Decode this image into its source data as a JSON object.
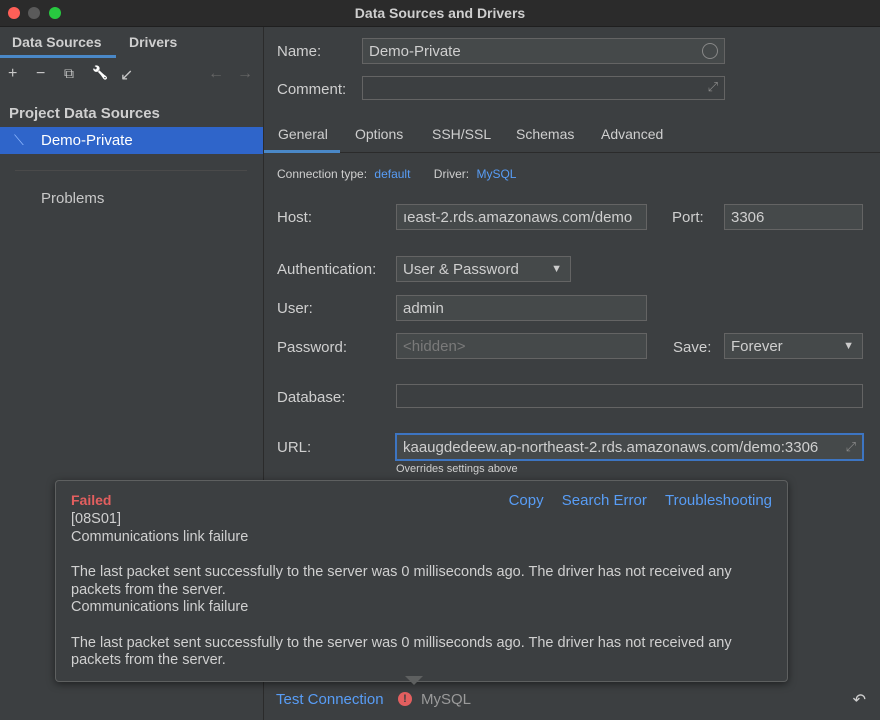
{
  "window": {
    "title": "Data Sources and Drivers"
  },
  "left": {
    "tabs": [
      "Data Sources",
      "Drivers"
    ],
    "section_title": "Project Data Sources",
    "data_source": "Demo-Private",
    "problems": "Problems",
    "toolbar": {
      "add": "+",
      "remove": "−",
      "copy": "⧉",
      "settings": "🔧",
      "import": "↙",
      "back": "←",
      "forward": "→"
    }
  },
  "form": {
    "name_label": "Name:",
    "name_value": "Demo-Private",
    "comment_label": "Comment:",
    "comment_value": "",
    "tabs": [
      "General",
      "Options",
      "SSH/SSL",
      "Schemas",
      "Advanced"
    ],
    "connection_type_label": "Connection type:",
    "connection_type": "default",
    "driver_label": "Driver:",
    "driver": "MySQL",
    "host_label": "Host:",
    "host_value": "ıeast-2.rds.amazonaws.com/demo",
    "port_label": "Port:",
    "port_value": "3306",
    "auth_label": "Authentication:",
    "auth_value": "User & Password",
    "user_label": "User:",
    "user_value": "admin",
    "password_label": "Password:",
    "password_placeholder": "<hidden>",
    "save_label": "Save:",
    "save_value": "Forever",
    "database_label": "Database:",
    "database_value": "",
    "url_label": "URL:",
    "url_value": "kaaugdedeew.ap-northeast-2.rds.amazonaws.com/demo:3306",
    "url_hint": "Overrides settings above"
  },
  "error_popup": {
    "status": "Failed",
    "actions": [
      "Copy",
      "Search Error",
      "Troubleshooting"
    ],
    "code": "[08S01]",
    "line1": "Communications link failure",
    "line2": "The last packet sent successfully to the server was 0 milliseconds ago. The driver has not received any packets from the server.",
    "line3": "Communications link failure",
    "line4": "The last packet sent successfully to the server was 0 milliseconds ago. The driver has not received any packets from the server."
  },
  "bottom": {
    "test_connection": "Test Connection",
    "error_icon": "!",
    "driver": "MySQL",
    "revert_icon": "↶"
  },
  "colors": {
    "accent": "#4a88c7",
    "selection": "#2f65ca",
    "link": "#589df6",
    "error": "#e35f5f"
  }
}
